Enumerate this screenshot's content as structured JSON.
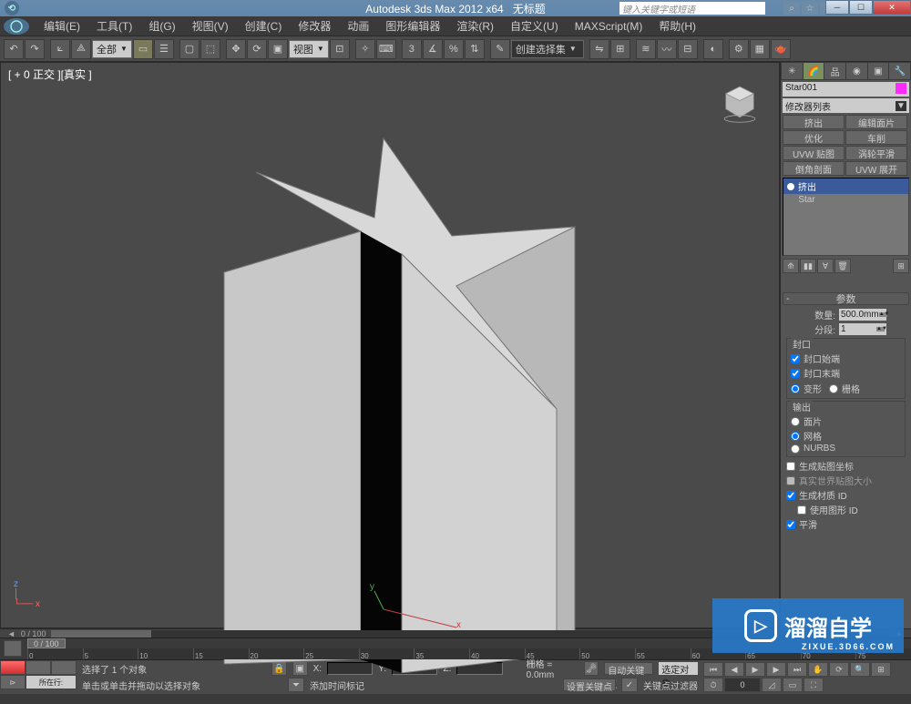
{
  "title": {
    "app": "Autodesk 3ds Max  2012 x64",
    "doc": "无标题"
  },
  "search_placeholder": "键入关键字或短语",
  "menu": [
    "编辑(E)",
    "工具(T)",
    "组(G)",
    "视图(V)",
    "创建(C)",
    "修改器",
    "动画",
    "图形编辑器",
    "渲染(R)",
    "自定义(U)",
    "MAXScript(M)",
    "帮助(H)"
  ],
  "toolbar": {
    "scope": "全部",
    "view": "视图",
    "selset": "创建选择集"
  },
  "viewport": {
    "label": "[ + 0 正交 ][真实 ]",
    "frame": "0 / 100"
  },
  "panel": {
    "object_name": "Star001",
    "mod_dropdown": "修改器列表",
    "mod_buttons": [
      "挤出",
      "编辑面片",
      "优化",
      "车削",
      "UVW 贴图",
      "涡轮平滑",
      "倒角剖面",
      "UVW 展开"
    ],
    "stack": {
      "top": "挤出",
      "base": "Star"
    },
    "rollout_params": "参数",
    "params": {
      "amount_lbl": "数量:",
      "amount_val": "500.0mm",
      "segs_lbl": "分段:",
      "segs_val": "1",
      "cap_group": "封口",
      "cap_start": "封口始端",
      "cap_end": "封口末端",
      "morph": "变形",
      "grid": "栅格",
      "out_group": "输出",
      "out_patch": "面片",
      "out_mesh": "网格",
      "out_nurbs": "NURBS",
      "gen_uv": "生成贴图坐标",
      "real_world": "真实世界贴图大小",
      "gen_mat": "生成材质 ID",
      "use_shape": "使用图形 ID",
      "smooth": "平滑"
    }
  },
  "timeline_ticks": [
    "0",
    "5",
    "10",
    "15",
    "20",
    "25",
    "30",
    "35",
    "40",
    "45",
    "50",
    "55",
    "60",
    "65",
    "70",
    "75"
  ],
  "status": {
    "sel_msg": "选择了 1 个对象",
    "hint": "单击或单击并拖动以选择对象",
    "x": "X:",
    "y": "Y:",
    "z": "Z:",
    "grid": "栅格 = 0.0mm",
    "autokey": "自动关键点",
    "selset": "选定对象",
    "setkey": "设置关键点",
    "keyfilter": "关键点过滤器",
    "addtime": "添加时间标记",
    "script_btn": "所在行:"
  },
  "watermark": {
    "name": "溜溜自学",
    "sub": "ZIXUE.3D66.COM"
  }
}
